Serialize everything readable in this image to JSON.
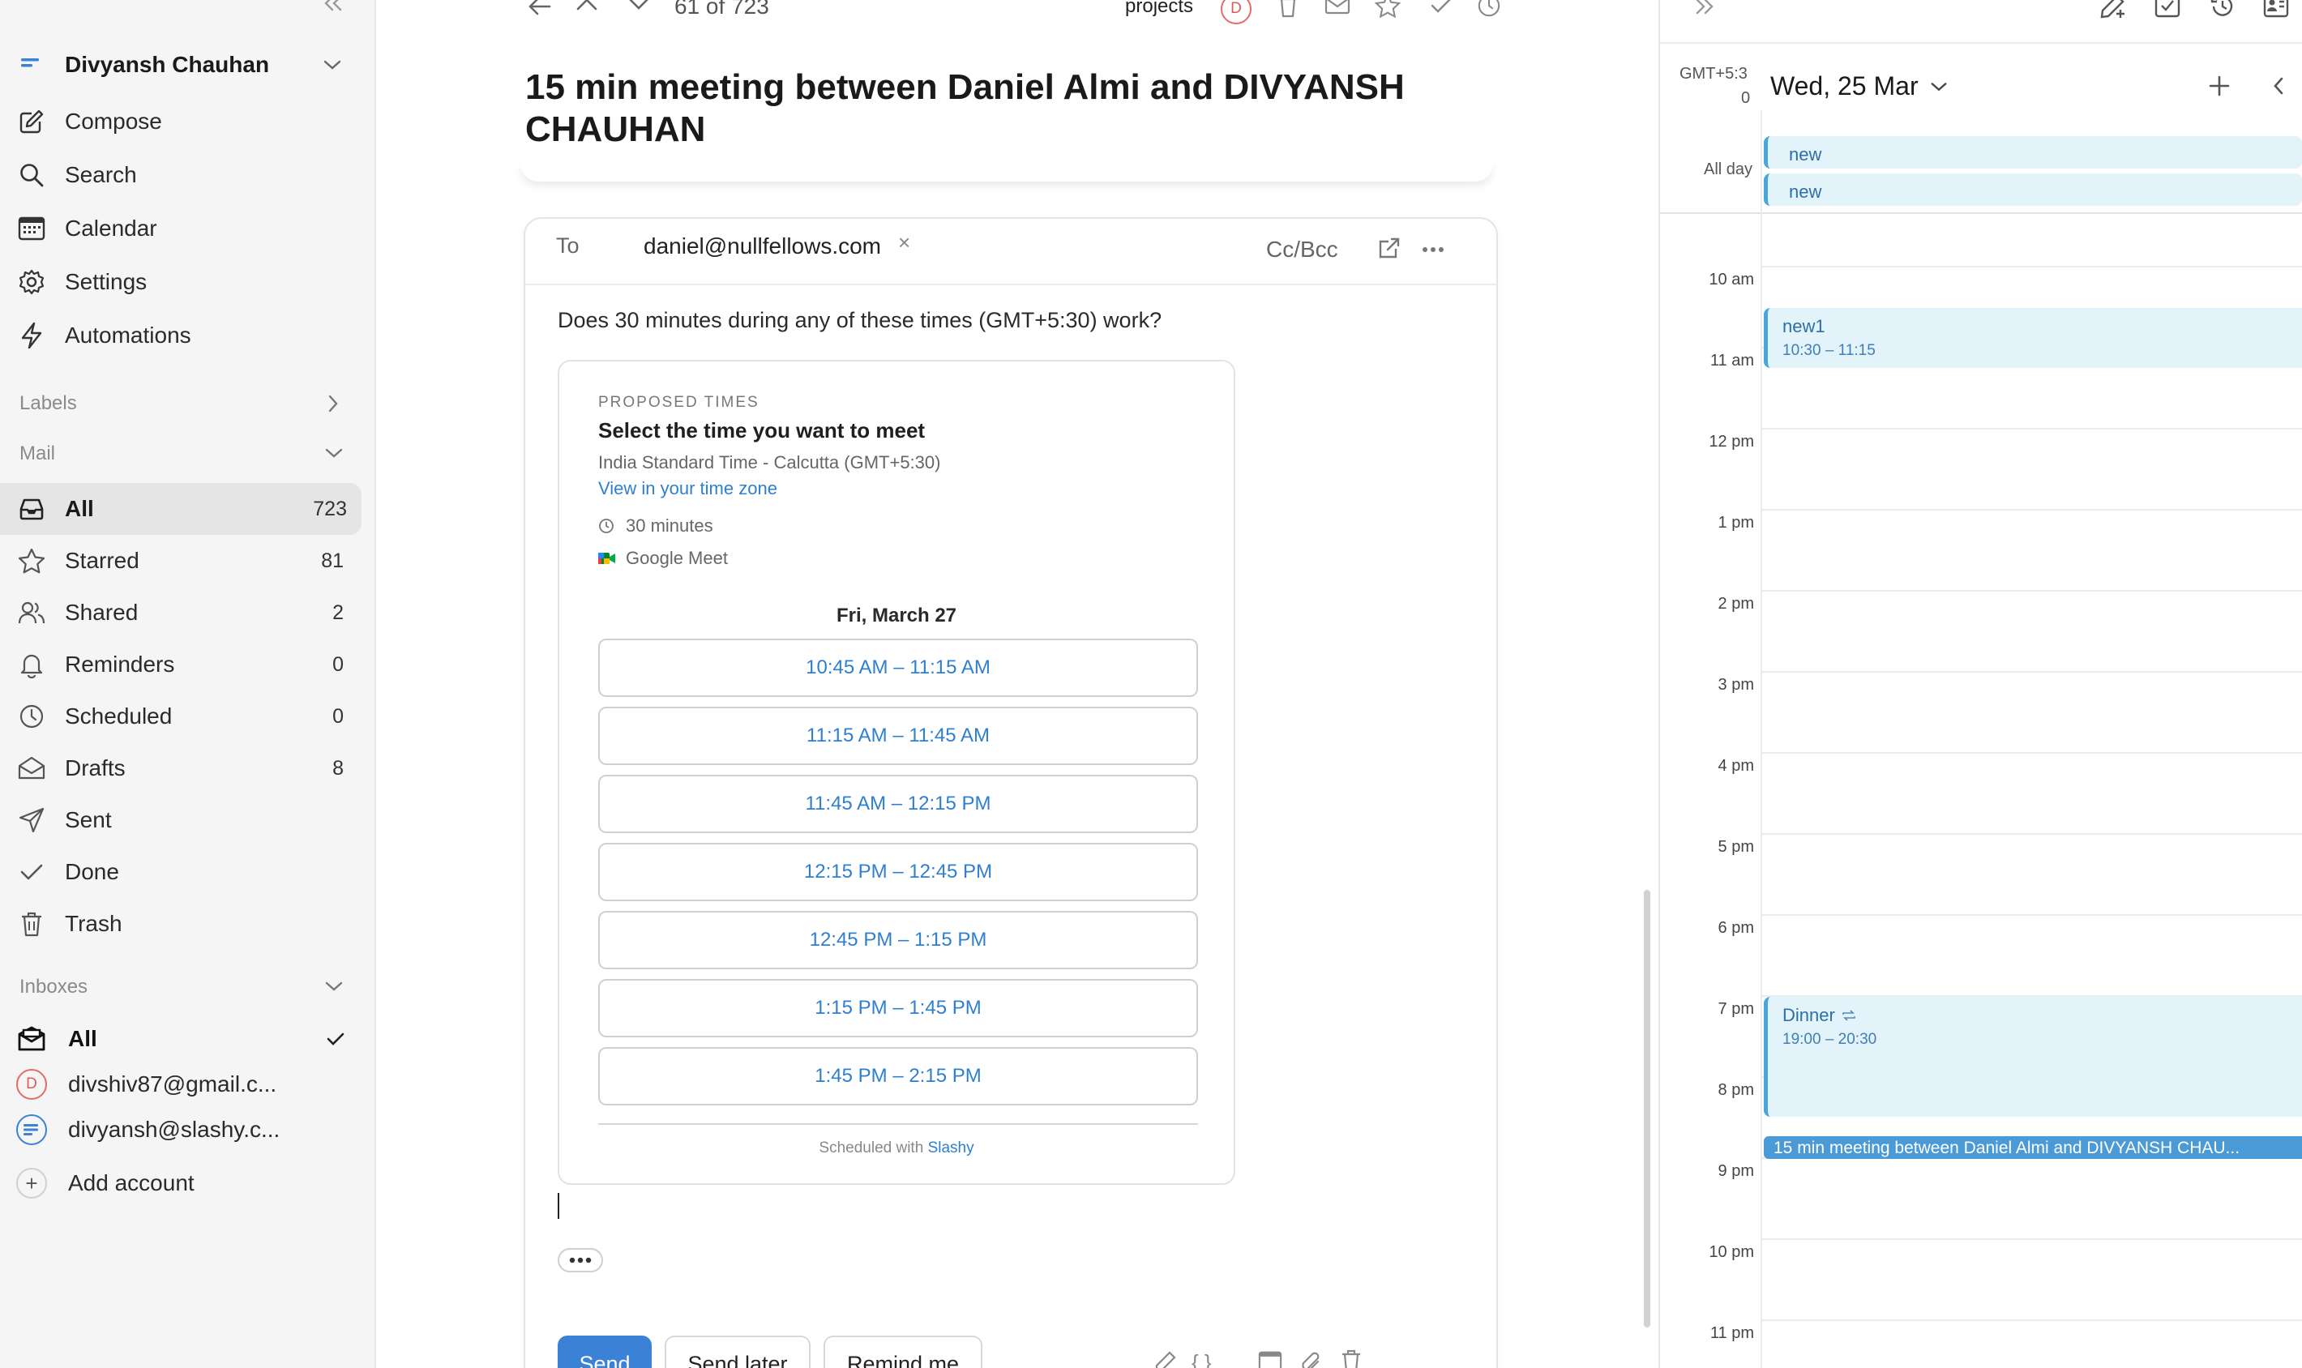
{
  "sidebar": {
    "account_name": "Divyansh Chauhan",
    "nav": [
      {
        "label": "Compose",
        "icon": "compose-icon"
      },
      {
        "label": "Search",
        "icon": "search-icon"
      },
      {
        "label": "Calendar",
        "icon": "calendar-icon"
      },
      {
        "label": "Settings",
        "icon": "gear-icon"
      },
      {
        "label": "Automations",
        "icon": "lightning-icon"
      }
    ],
    "labels_header": "Labels",
    "mail_header": "Mail",
    "mail_items": [
      {
        "label": "All",
        "count": "723",
        "icon": "inbox-icon",
        "selected": true
      },
      {
        "label": "Starred",
        "count": "81",
        "icon": "star-icon"
      },
      {
        "label": "Shared",
        "count": "2",
        "icon": "people-icon"
      },
      {
        "label": "Reminders",
        "count": "0",
        "icon": "bell-icon"
      },
      {
        "label": "Scheduled",
        "count": "0",
        "icon": "clock-icon"
      },
      {
        "label": "Drafts",
        "count": "8",
        "icon": "envelope-open-icon"
      },
      {
        "label": "Sent",
        "count": "",
        "icon": "send-icon"
      },
      {
        "label": "Done",
        "count": "",
        "icon": "check-icon"
      },
      {
        "label": "Trash",
        "count": "",
        "icon": "trash-icon"
      }
    ],
    "inboxes_header": "Inboxes",
    "inboxes": [
      {
        "label": "All",
        "icon": "inbox-all-icon"
      },
      {
        "label": "divshiv87@gmail.c...",
        "initial": "D"
      },
      {
        "label": "divyansh@slashy.c..."
      }
    ],
    "add_account": "Add account"
  },
  "toolbar": {
    "position": "61 of 723",
    "label_tag": "projects",
    "avatar_initial": "D"
  },
  "email": {
    "subject": "15 min meeting between Daniel Almi and DIVYANSH CHAUHAN",
    "to_label": "To",
    "to_address": "daniel@nullfellows.com",
    "ccbcc": "Cc/Bcc",
    "intro": "Does 30 minutes during any of these times (GMT+5:30) work?",
    "card": {
      "eyebrow": "PROPOSED TIMES",
      "title": "Select the time you want to meet",
      "timezone": "India Standard Time - Calcutta (GMT+5:30)",
      "tz_link": "View in your time zone",
      "duration": "30 minutes",
      "location": "Google Meet",
      "date": "Fri, March 27",
      "slots": [
        "10:45 AM – 11:15 AM",
        "11:15 AM – 11:45 AM",
        "11:45 AM – 12:15 PM",
        "12:15 PM – 12:45 PM",
        "12:45 PM – 1:15 PM",
        "1:15 PM – 1:45 PM",
        "1:45 PM – 2:15 PM"
      ],
      "footer_prefix": "Scheduled with",
      "footer_brand": "Slashy"
    },
    "buttons": {
      "send": "Send",
      "send_later": "Send later",
      "remind_me": "Remind me"
    }
  },
  "calendar": {
    "tz": "GMT+5:3",
    "tz2": "0",
    "date": "Wed, 25 Mar",
    "allday_label": "All day",
    "allday_events": [
      "new",
      "new"
    ],
    "hours": [
      "10 am",
      "11 am",
      "12 pm",
      "1 pm",
      "2 pm",
      "3 pm",
      "4 pm",
      "5 pm",
      "6 pm",
      "7 pm",
      "8 pm",
      "9 pm",
      "10 pm",
      "11 pm"
    ],
    "events": [
      {
        "title": "new1",
        "time": "10:30 – 11:15"
      },
      {
        "title": "Dinner",
        "time": "19:00 – 20:30",
        "recurring": true
      },
      {
        "title": "15 min meeting between Daniel Almi and DIVYANSH CHAU..."
      }
    ],
    "colors": {
      "event_bg": "#e3f3fa",
      "event_border": "#4aa5dd",
      "highlight": "#4a9ad8"
    }
  },
  "colors": {
    "accent": "#3b82d6",
    "link": "#2f7fd0"
  }
}
